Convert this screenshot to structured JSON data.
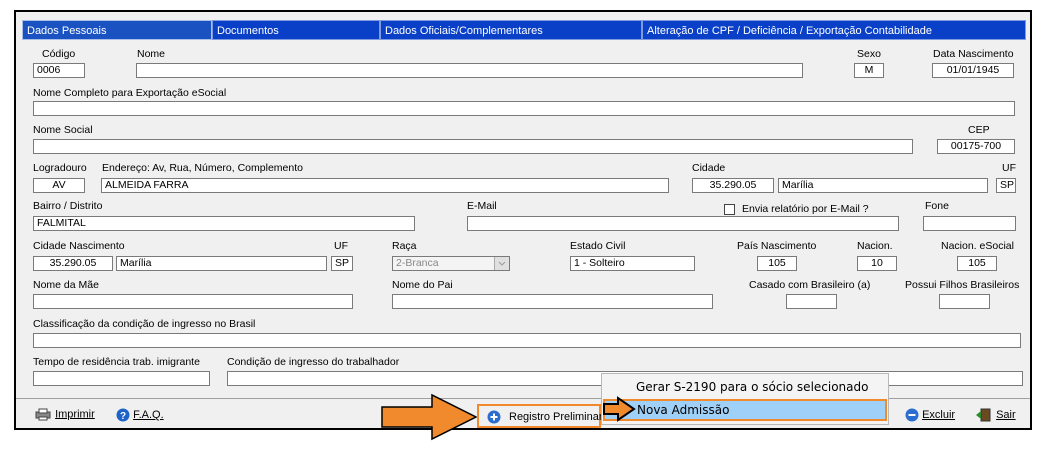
{
  "tabs": [
    "Dados Pessoais",
    "Documentos",
    "Dados Oficiais/Complementares",
    "Alteração de CPF / Deficiência / Exportação Contabilidade"
  ],
  "labels": {
    "codigo": "Código",
    "nome": "Nome",
    "sexo": "Sexo",
    "data_nasc": "Data Nascimento",
    "nome_completo": "Nome Completo para Exportação eSocial",
    "nome_social": "Nome Social",
    "cep": "CEP",
    "logradouro": "Logradouro",
    "endereco": "Endereço: Av, Rua, Número, Complemento",
    "cidade": "Cidade",
    "uf": "UF",
    "bairro": "Bairro / Distrito",
    "email": "E-Mail",
    "envia": "Envia relatório por E-Mail ?",
    "fone": "Fone",
    "cidade_nasc": "Cidade Nascimento",
    "uf2": "UF",
    "raca": "Raça",
    "estado_civil": "Estado Civil",
    "pais_nasc": "País Nascimento",
    "nacion": "Nacion.",
    "nacion_esocial": "Nacion. eSocial",
    "nome_mae": "Nome da Mãe",
    "nome_pai": "Nome do Pai",
    "casado": "Casado com Brasileiro (a)",
    "filhos": "Possui Filhos Brasileiros",
    "classificacao": "Classificação da condição de ingresso no Brasil",
    "tempo": "Tempo de residência trab. imigrante",
    "condicao": "Condição de ingresso do trabalhador"
  },
  "values": {
    "codigo": "0006",
    "sexo": "M",
    "data_nasc": "01/01/1945",
    "cep": "00175-700",
    "logradouro": "AV",
    "endereco": "ALMEIDA FARRA",
    "cidade_cod": "35.290.05",
    "cidade_nome": "Marília",
    "uf": "SP",
    "bairro": "FALMITAL",
    "cidade_nasc_cod": "35.290.05",
    "cidade_nasc_nome": "Marília",
    "uf2": "SP",
    "raca": "2-Branca",
    "estado_civil": "1 - Solteiro",
    "pais_nasc": "105",
    "nacion": "10",
    "nacion_esocial": "105"
  },
  "bottom": {
    "imprimir": "Imprimir",
    "faq": "F.A.Q.",
    "registro": "Registro Preliminar",
    "excluir": "Excluir",
    "sair": "Sair"
  },
  "menu": {
    "item1": "Gerar S-2190 para o sócio selecionado",
    "item2": "Nova Admissão"
  },
  "colors": {
    "tab_active": "#1a52c2",
    "highlight": "#9fd0f7",
    "orange": "#f08a2c"
  }
}
